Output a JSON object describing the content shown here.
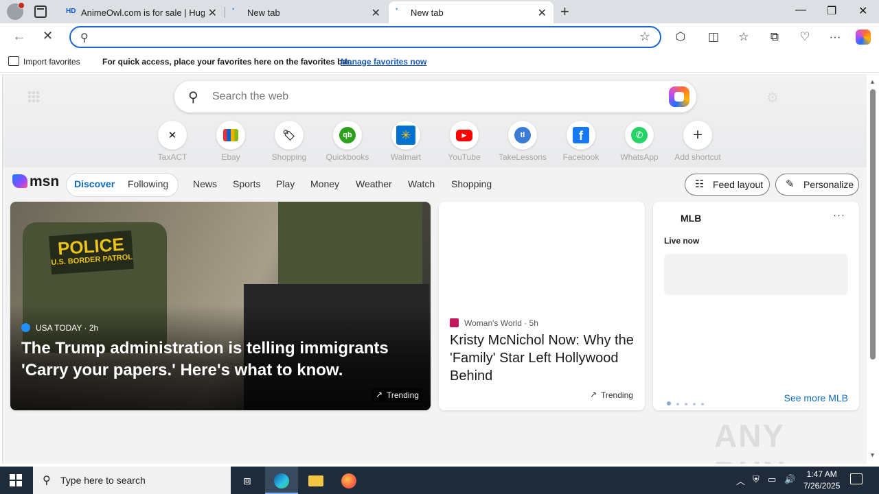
{
  "tabs": [
    {
      "favicon": "HD",
      "title": "AnimeOwl.com is for sale | HugeD"
    },
    {
      "favicon": "edge-icon",
      "title": "New tab"
    },
    {
      "favicon": "edge-icon",
      "title": "New tab",
      "active": true
    }
  ],
  "favorites_bar": {
    "import_label": "Import favorites",
    "message": "For quick access, place your favorites here on the favorites bar.",
    "manage_link": "Manage favorites now"
  },
  "address_bar": {
    "value": "",
    "placeholder": ""
  },
  "search": {
    "placeholder": "Search the web"
  },
  "quick_links": [
    {
      "label": "TaxACT",
      "icon": "taxact-icon",
      "color": "#1b1b1b"
    },
    {
      "label": "Ebay",
      "icon": "ebay-icon",
      "color": "#e53238"
    },
    {
      "label": "Shopping",
      "icon": "tag-icon",
      "color": "#1b1b1b"
    },
    {
      "label": "Quickbooks",
      "icon": "quickbooks-icon",
      "color": "#2ca01c"
    },
    {
      "label": "Walmart",
      "icon": "walmart-icon",
      "color": "#0071ce"
    },
    {
      "label": "YouTube",
      "icon": "youtube-icon",
      "color": "#ff0000"
    },
    {
      "label": "TakeLessons",
      "icon": "takelessons-icon",
      "color": "#3a7bd5"
    },
    {
      "label": "Facebook",
      "icon": "facebook-icon",
      "color": "#1877f2"
    },
    {
      "label": "WhatsApp",
      "icon": "whatsapp-icon",
      "color": "#25d366"
    },
    {
      "label": "Add shortcut",
      "icon": "plus-icon",
      "color": "#333333"
    }
  ],
  "msn": {
    "logo": "msn",
    "feed_tabs": [
      "Discover",
      "Following"
    ],
    "active_tab": "Discover",
    "nav": [
      "News",
      "Sports",
      "Play",
      "Money",
      "Weather",
      "Watch",
      "Shopping"
    ],
    "feed_layout": "Feed layout",
    "personalize": "Personalize"
  },
  "cards": {
    "main": {
      "source": "USA TODAY",
      "age": "2h",
      "headline": "The Trump administration is telling immigrants 'Carry your papers.' Here's what to know.",
      "patch_line1": "POLICE",
      "patch_line2": "U.S. BORDER PATROL",
      "tag": "Trending"
    },
    "mid": {
      "source": "Woman's World",
      "age": "5h",
      "headline": "Kristy McNichol Now: Why the 'Family' Star Left Hollywood Behind",
      "tag": "Trending"
    },
    "mlb": {
      "title": "MLB",
      "live": "Live now",
      "see_more": "See more MLB"
    }
  },
  "watermark": "ANY RUN",
  "taskbar": {
    "search_placeholder": "Type here to search",
    "time": "1:47 AM",
    "date": "7/26/2025"
  },
  "colors": {
    "accent": "#0f6cbd",
    "address_border": "#1a67d2",
    "taskbar": "#1f2b3a"
  }
}
